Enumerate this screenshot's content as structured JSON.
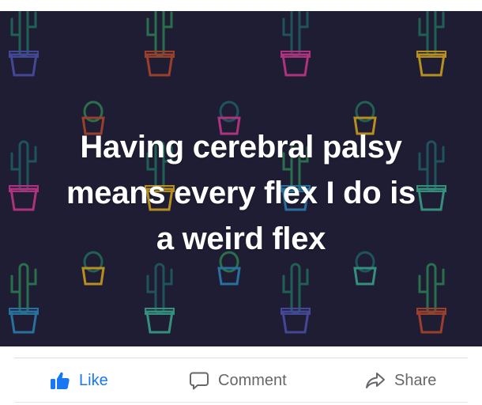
{
  "post": {
    "text_lines": [
      "Having cerebral palsy",
      "means every flex I do is",
      "a weird flex"
    ],
    "background_color": "#1f1d33",
    "text_color": "#ffffff",
    "background_pattern": "cactus-in-pot-pattern"
  },
  "actions": {
    "like_label": "Like",
    "comment_label": "Comment",
    "share_label": "Share",
    "like_icon": "thumbs-up-icon",
    "comment_icon": "speech-bubble-icon",
    "share_icon": "share-arrow-icon",
    "like_color": "#1877f2",
    "default_color": "#65676b"
  }
}
